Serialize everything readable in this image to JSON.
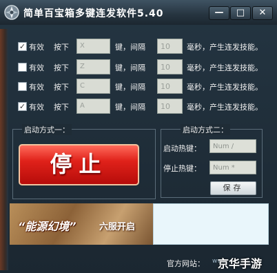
{
  "window": {
    "title": "简单百宝箱多键连发软件5.40",
    "controls": {
      "minimize": "—",
      "maximize": "□",
      "close": "✕"
    }
  },
  "key_rows": [
    {
      "enabled": true,
      "enabled_label": "有效",
      "press_label": "按下",
      "key": "X",
      "interval_label": "键，间隔",
      "interval_ms": "10",
      "suffix": "毫秒，产生连发技能。"
    },
    {
      "enabled": false,
      "enabled_label": "有效",
      "press_label": "按下",
      "key": "Z",
      "interval_label": "键，间隔",
      "interval_ms": "10",
      "suffix": "毫秒，产生连发技能。"
    },
    {
      "enabled": false,
      "enabled_label": "有效",
      "press_label": "按下",
      "key": "C",
      "interval_label": "键，间隔",
      "interval_ms": "10",
      "suffix": "毫秒，产生连发技能。"
    },
    {
      "enabled": true,
      "enabled_label": "有效",
      "press_label": "按下",
      "key": "A",
      "interval_label": "键，间隔",
      "interval_ms": "10",
      "suffix": "毫秒，产生连发技能。"
    }
  ],
  "start_mode_1": {
    "label": "启动方式一：",
    "stop_button_label": "停止"
  },
  "start_mode_2": {
    "label": "启动方式二：",
    "start_hotkey_label": "启动热键：",
    "start_hotkey_value": "Num /",
    "stop_hotkey_label": "停止热键：",
    "stop_hotkey_value": "Num *",
    "save_button_label": "保存"
  },
  "banner": {
    "title": "“能源幻境”",
    "subtitle": "六服开启"
  },
  "footer": {
    "website_label": "官方网站：",
    "website_link": "www"
  },
  "watermark": "京华手游",
  "colors": {
    "window_bg": "#1d2a34",
    "stop_button": "#d81e16",
    "input_bg": "#d9dcd4",
    "ad_bg": "#e9f6fb"
  }
}
